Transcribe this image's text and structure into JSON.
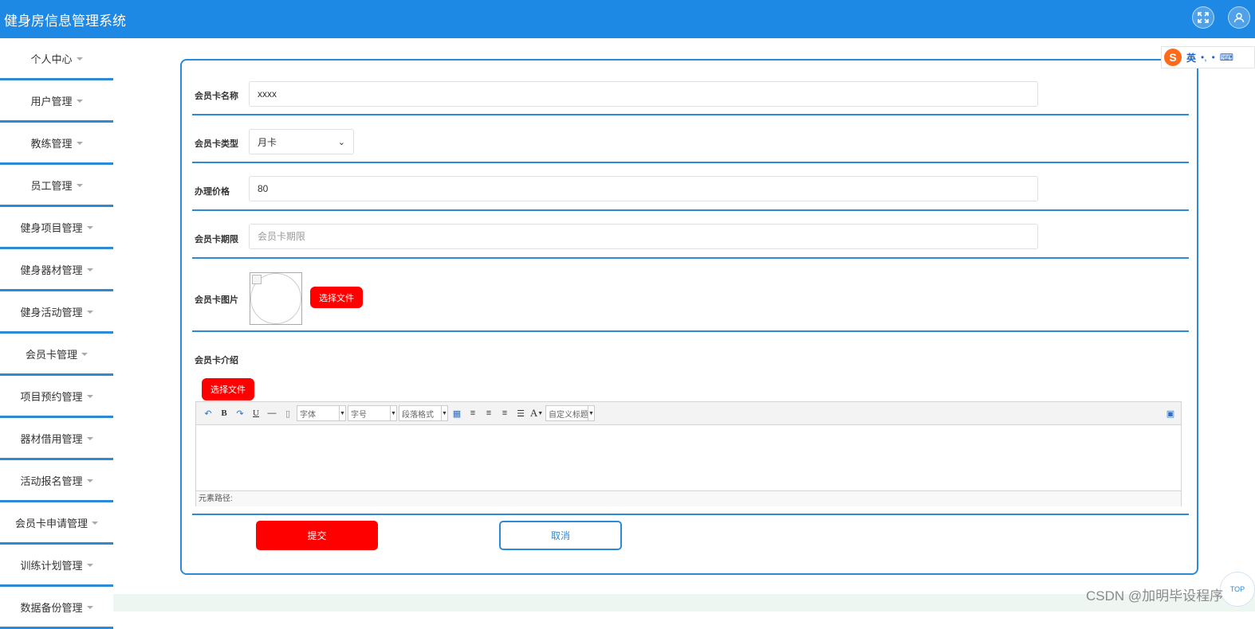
{
  "header": {
    "title": "健身房信息管理系统"
  },
  "sidebar": {
    "items": [
      {
        "label": "个人中心"
      },
      {
        "label": "用户管理"
      },
      {
        "label": "教练管理"
      },
      {
        "label": "员工管理"
      },
      {
        "label": "健身项目管理"
      },
      {
        "label": "健身器材管理"
      },
      {
        "label": "健身活动管理"
      },
      {
        "label": "会员卡管理"
      },
      {
        "label": "项目预约管理"
      },
      {
        "label": "器材借用管理"
      },
      {
        "label": "活动报名管理"
      },
      {
        "label": "会员卡申请管理"
      },
      {
        "label": "训练计划管理"
      },
      {
        "label": "数据备份管理"
      }
    ]
  },
  "form": {
    "name": {
      "label": "会员卡名称",
      "value": "xxxx"
    },
    "type": {
      "label": "会员卡类型",
      "value": "月卡"
    },
    "price": {
      "label": "办理价格",
      "value": "80"
    },
    "period": {
      "label": "会员卡期限",
      "placeholder": "会员卡期限"
    },
    "image": {
      "label": "会员卡图片",
      "button": "选择文件"
    },
    "intro": {
      "label": "会员卡介绍",
      "button": "选择文件"
    },
    "editor": {
      "font_family": "字体",
      "font_size": "字号",
      "paragraph": "段落格式",
      "custom_title": "自定义标题",
      "text_color_glyph": "A",
      "status": "元素路径:"
    },
    "submit": "提交",
    "cancel": "取消"
  },
  "ime": {
    "mode": "英",
    "punct": "•,"
  },
  "scroll_top": "TOP",
  "watermark": "CSDN @加明毕设程序",
  "colors": {
    "header": "#1e88e5",
    "accent": "#2d8ad6",
    "button_red": "#ff0000"
  }
}
